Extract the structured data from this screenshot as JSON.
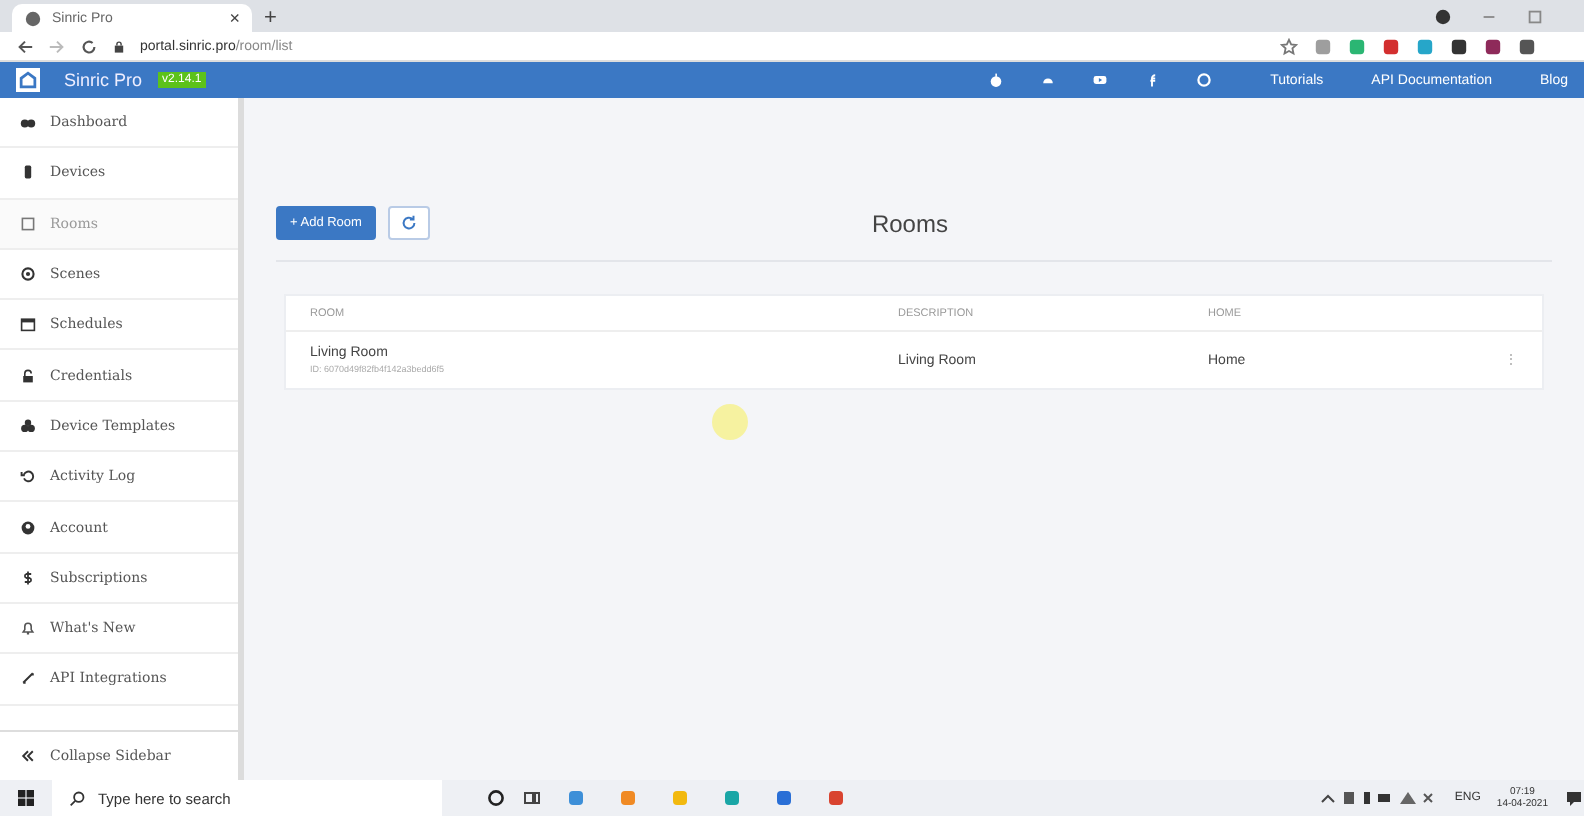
{
  "browser": {
    "tab_title": "Sinric Pro",
    "tab_close": "×",
    "new_tab": "+",
    "url_host": "portal.sinric.pro",
    "url_path": "/room/list"
  },
  "header": {
    "brand": "Sinric Pro",
    "version": "v2.14.1",
    "links": [
      "Tutorials",
      "API Documentation",
      "Blog"
    ]
  },
  "sidebar": {
    "items": [
      {
        "label": "Dashboard",
        "kind": "dashboard",
        "selected": false
      },
      {
        "label": "Devices",
        "kind": "device",
        "selected": false
      },
      {
        "label": "Rooms",
        "kind": "room",
        "selected": true
      },
      {
        "label": "Scenes",
        "kind": "scene",
        "selected": false
      },
      {
        "label": "Schedules",
        "kind": "calendar",
        "selected": false
      },
      {
        "label": "Credentials",
        "kind": "lock",
        "selected": false
      },
      {
        "label": "Device Templates",
        "kind": "templates",
        "selected": false
      },
      {
        "label": "Activity Log",
        "kind": "history",
        "selected": false
      },
      {
        "label": "Account",
        "kind": "account",
        "selected": false
      },
      {
        "label": "Subscriptions",
        "kind": "dollar",
        "selected": false
      },
      {
        "label": "What's New",
        "kind": "bell",
        "selected": false
      },
      {
        "label": "API Integrations",
        "kind": "api",
        "selected": false
      }
    ],
    "collapse": "Collapse Sidebar"
  },
  "main": {
    "add_button": "+ Add Room",
    "title": "Rooms",
    "table": {
      "columns": [
        "ROOM",
        "DESCRIPTION",
        "HOME"
      ],
      "rows": [
        {
          "name": "Living Room",
          "id": "ID: 6070d49f82fb4f142a3bedd6f5",
          "description": "Living Room",
          "home": "Home",
          "menu": "⋮"
        }
      ]
    }
  },
  "taskbar": {
    "search_placeholder": "Type here to search",
    "language": "ENG",
    "time": "07:19",
    "date": "14-04-2021"
  }
}
